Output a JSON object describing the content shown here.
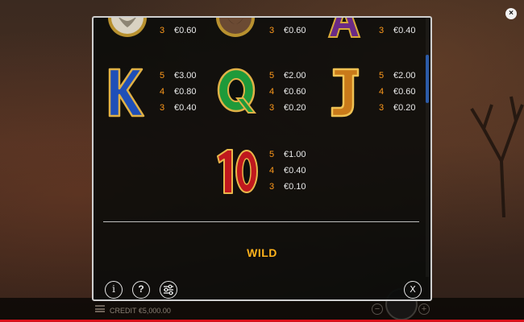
{
  "outer_close_glyph": "×",
  "background": {
    "credit_label": "CREDIT €5,000.00",
    "minus_glyph": "−",
    "plus_glyph": "+"
  },
  "paytable": {
    "top_row": [
      {
        "symbol": "wolf",
        "pays": [
          {
            "count": "3",
            "value": "€0.60"
          }
        ]
      },
      {
        "symbol": "bison",
        "pays": [
          {
            "count": "3",
            "value": "€0.60"
          }
        ]
      },
      {
        "symbol": "A",
        "pays": [
          {
            "count": "3",
            "value": "€0.40"
          }
        ]
      }
    ],
    "mid_row": [
      {
        "symbol": "K",
        "pays": [
          {
            "count": "5",
            "value": "€3.00"
          },
          {
            "count": "4",
            "value": "€0.80"
          },
          {
            "count": "3",
            "value": "€0.40"
          }
        ]
      },
      {
        "symbol": "Q",
        "pays": [
          {
            "count": "5",
            "value": "€2.00"
          },
          {
            "count": "4",
            "value": "€0.60"
          },
          {
            "count": "3",
            "value": "€0.20"
          }
        ]
      },
      {
        "symbol": "J",
        "pays": [
          {
            "count": "5",
            "value": "€2.00"
          },
          {
            "count": "4",
            "value": "€0.60"
          },
          {
            "count": "3",
            "value": "€0.20"
          }
        ]
      }
    ],
    "ten": {
      "symbol": "10",
      "pays": [
        {
          "count": "5",
          "value": "€1.00"
        },
        {
          "count": "4",
          "value": "€0.40"
        },
        {
          "count": "3",
          "value": "€0.10"
        }
      ]
    },
    "wild_title": "WILD"
  },
  "footer": {
    "info_glyph": "i",
    "help_glyph": "?",
    "close_glyph": "X"
  }
}
